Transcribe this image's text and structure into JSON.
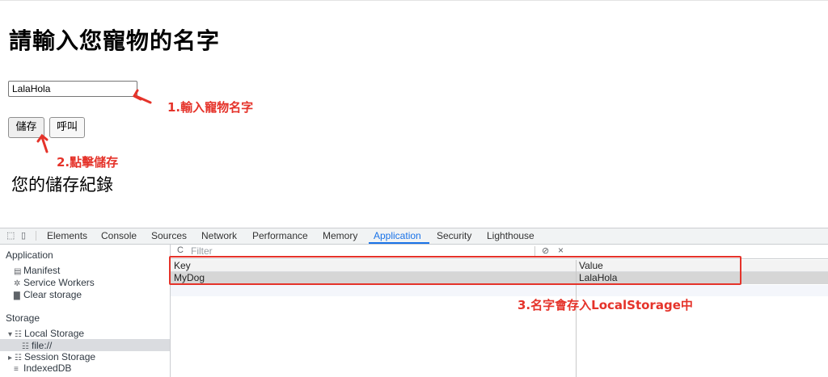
{
  "page": {
    "title": "請輸入您寵物的名字",
    "name_input_value": "LalaHola",
    "save_button": "儲存",
    "call_button": "呼叫",
    "records_title": "您的儲存紀錄"
  },
  "annotations": {
    "step1": "1.輸入寵物名字",
    "step2": "2.點擊儲存",
    "step3": "3.名字會存入LocalStorage中",
    "color": "#e5332a"
  },
  "devtools": {
    "tabs": [
      "Elements",
      "Console",
      "Sources",
      "Network",
      "Performance",
      "Memory",
      "Application",
      "Security",
      "Lighthouse"
    ],
    "active_tab": "Application",
    "sidebar": {
      "application_header": "Application",
      "application_items": [
        {
          "icon": "file-icon",
          "label": "Manifest"
        },
        {
          "icon": "gear-icon",
          "label": "Service Workers"
        },
        {
          "icon": "trash-icon",
          "label": "Clear storage"
        }
      ],
      "storage_header": "Storage",
      "storage_items": [
        {
          "icon": "grid-icon",
          "label": "Local Storage",
          "expanded": true
        },
        {
          "icon": "grid-icon",
          "label": "file://",
          "selected": true
        },
        {
          "icon": "grid-icon",
          "label": "Session Storage",
          "expanded": false
        },
        {
          "icon": "database-icon",
          "label": "IndexedDB"
        }
      ]
    },
    "filter_placeholder": "Filter",
    "table": {
      "columns": [
        "Key",
        "Value"
      ],
      "rows": [
        {
          "key": "MyDog",
          "value": "LalaHola"
        }
      ]
    }
  }
}
